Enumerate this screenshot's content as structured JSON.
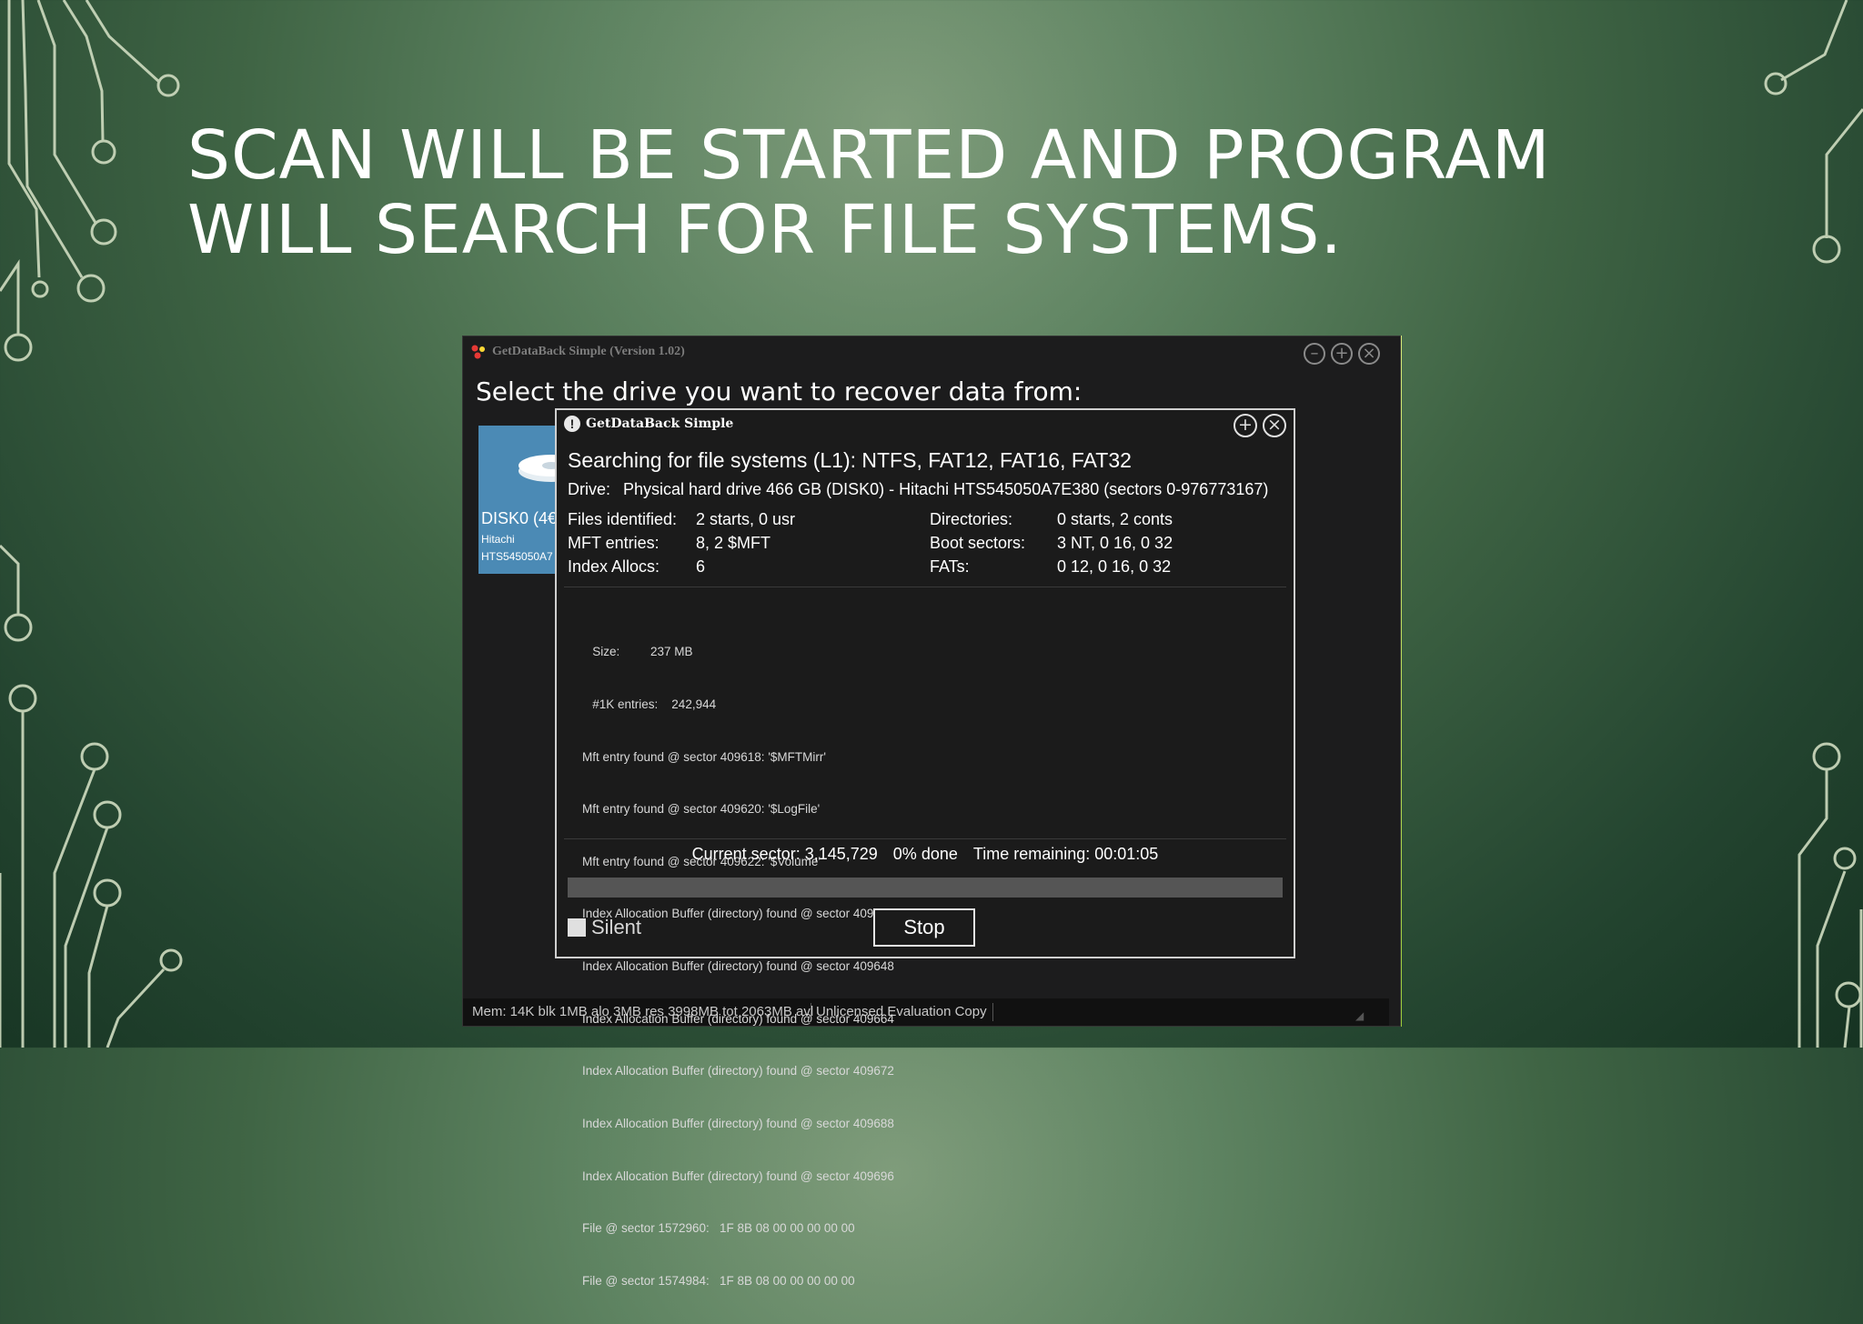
{
  "slide": {
    "title_line1": "SCAN WILL BE STARTED AND PROGRAM",
    "title_line2": "WILL SEARCH FOR FILE SYSTEMS."
  },
  "app": {
    "title": "GetDataBack Simple (Version 1.02)",
    "heading": "Select the drive you want to recover data from:",
    "window_controls": [
      "minimize-icon",
      "maximize-icon",
      "close-icon"
    ],
    "drive_tile": {
      "name": "DISK0 (4€",
      "vendor": "Hitachi",
      "model": "HTS545050A7"
    },
    "status_bar": {
      "mem": "Mem: 14K blk 1MB alo 3MB res 3998MB tot 2063MB avl",
      "license": "Unlicensed Evaluation Copy"
    }
  },
  "dialog": {
    "title": "GetDataBack Simple",
    "icon": "info-icon",
    "searching": "Searching for file systems (L1): NTFS, FAT12, FAT16, FAT32",
    "drive_label": "Drive:",
    "drive_value": "Physical hard drive 466 GB (DISK0) - Hitachi HTS545050A7E380 (sectors 0-976773167)",
    "stats": {
      "files_identified_label": "Files identified:",
      "files_identified_value": "2 starts, 0 usr",
      "mft_entries_label": "MFT entries:",
      "mft_entries_value": "8, 2 $MFT",
      "index_allocs_label": "Index Allocs:",
      "index_allocs_value": "6",
      "directories_label": "Directories:",
      "directories_value": "0 starts, 2 conts",
      "boot_sectors_label": "Boot sectors:",
      "boot_sectors_value": "3 NT, 0 16, 0 32",
      "fats_label": "FATs:",
      "fats_value": "0 12, 0 16, 0 32"
    },
    "log": [
      "   Size:         237 MB",
      "   #1K entries:    242,944",
      "Mft entry found @ sector 409618: '$MFTMirr'",
      "Mft entry found @ sector 409620: '$LogFile'",
      "Mft entry found @ sector 409622: '$Volume'",
      "Index Allocation Buffer (directory) found @ sector 409640",
      "Index Allocation Buffer (directory) found @ sector 409648",
      "Index Allocation Buffer (directory) found @ sector 409664",
      "Index Allocation Buffer (directory) found @ sector 409672",
      "Index Allocation Buffer (directory) found @ sector 409688",
      "Index Allocation Buffer (directory) found @ sector 409696",
      "File @ sector 1572960:   1F 8B 08 00 00 00 00 00",
      "File @ sector 1574984:   1F 8B 08 00 00 00 00 00"
    ],
    "current_sector": "Current sector: 3,145,729",
    "percent_done": "0% done",
    "time_remaining": "Time remaining: 00:01:05",
    "progress_fraction": 0,
    "silent_label": "Silent",
    "silent_checked": false,
    "stop_label": "Stop"
  }
}
